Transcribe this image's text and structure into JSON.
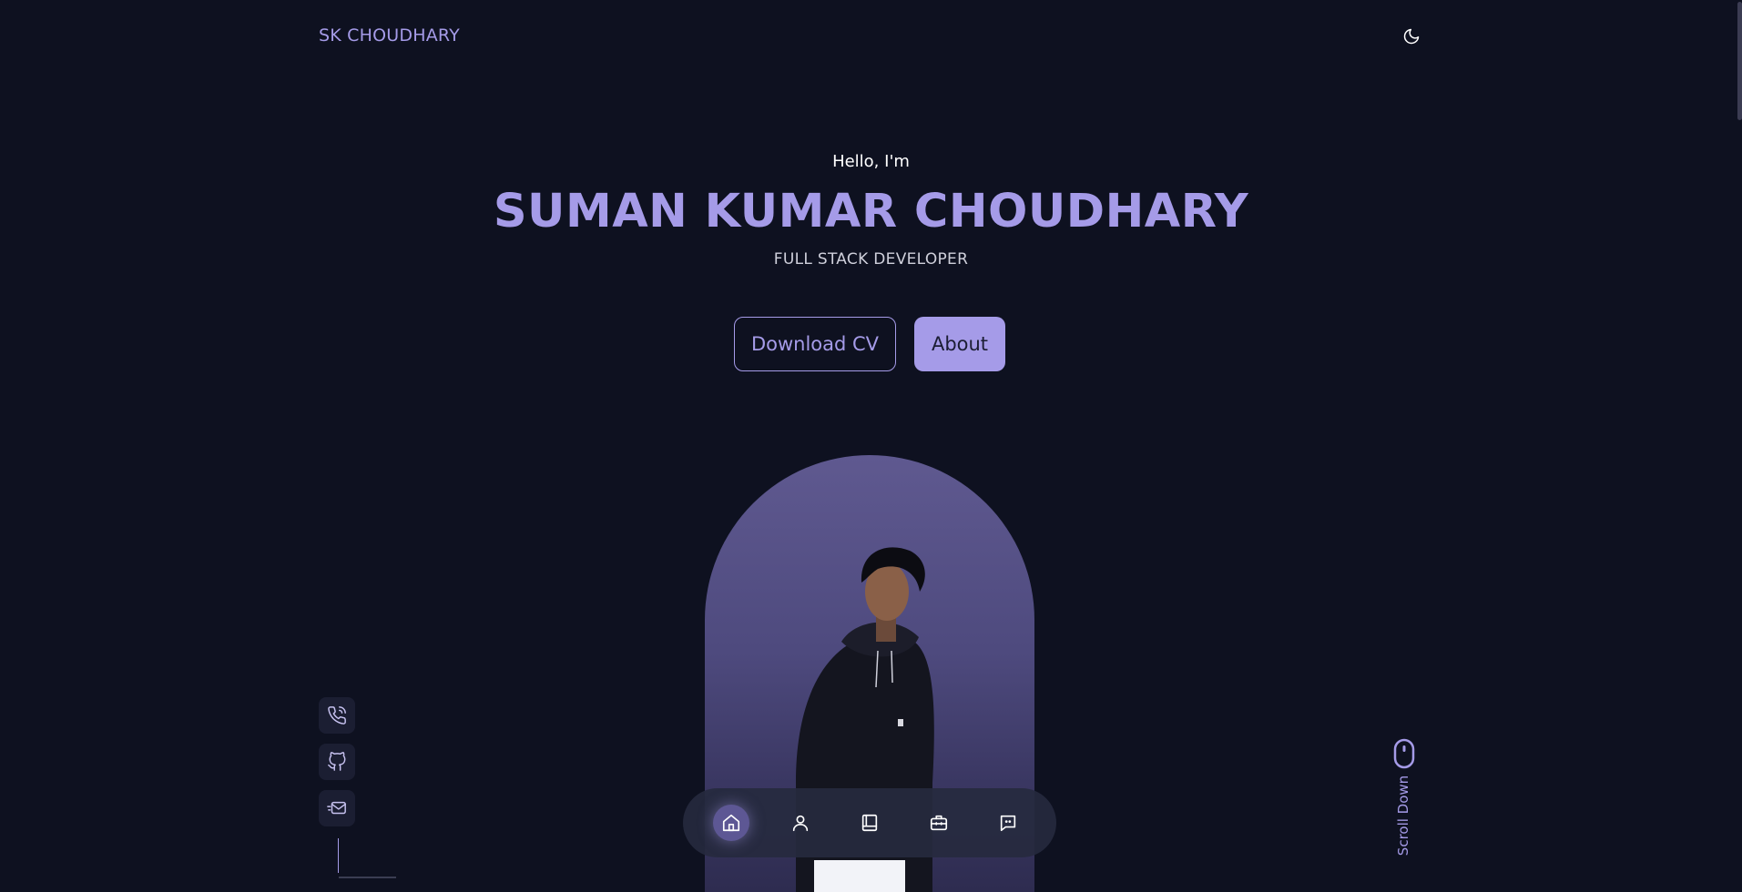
{
  "header": {
    "logo": "SK CHOUDHARY",
    "theme_icon": "moon-icon"
  },
  "hero": {
    "greeting": "Hello, I'm",
    "name": "SUMAN KUMAR CHOUDHARY",
    "role": "FULL STACK DEVELOPER",
    "download_cv_label": "Download CV",
    "about_label": "About"
  },
  "social_links": [
    {
      "icon": "phone-icon"
    },
    {
      "icon": "github-icon"
    },
    {
      "icon": "mail-icon"
    }
  ],
  "scroll_down": {
    "label": "Scroll Down",
    "icon": "mouse-icon"
  },
  "bottom_nav": {
    "items": [
      {
        "icon": "home-icon",
        "active": true
      },
      {
        "icon": "user-icon",
        "active": false
      },
      {
        "icon": "book-icon",
        "active": false
      },
      {
        "icon": "briefcase-icon",
        "active": false
      },
      {
        "icon": "chat-icon",
        "active": false
      }
    ]
  },
  "colors": {
    "background": "#0e1120",
    "accent": "#a59be8",
    "nav_background": "#262a3e"
  }
}
